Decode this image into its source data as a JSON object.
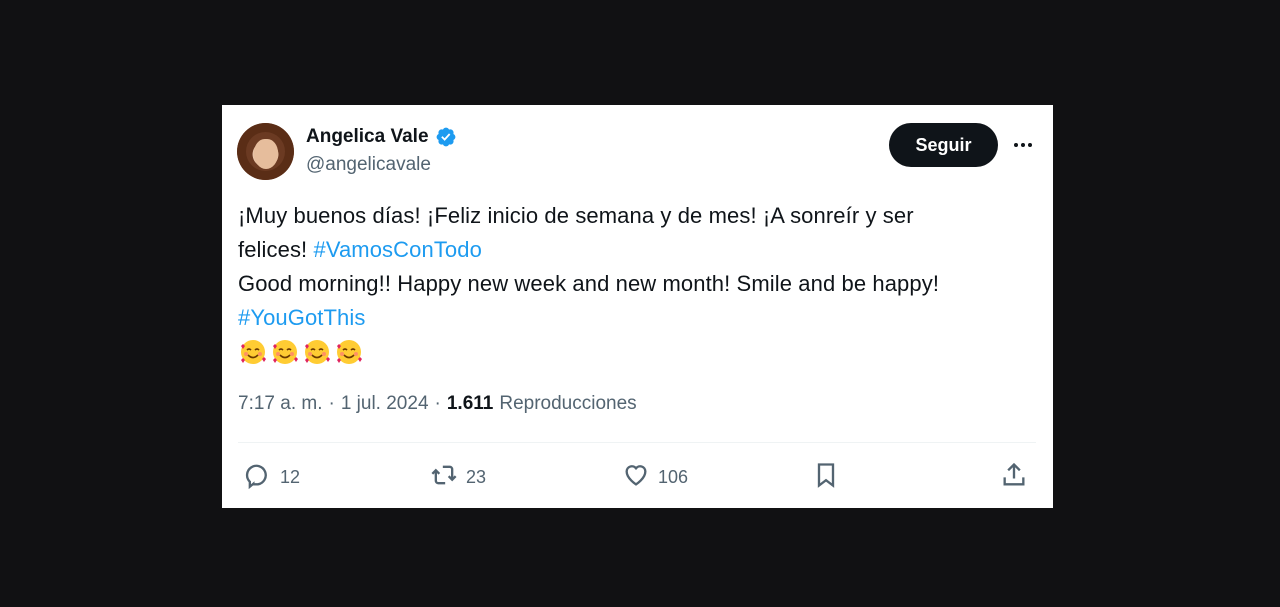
{
  "author": {
    "name": "Angelica Vale",
    "handle": "@angelicavale",
    "verified": true
  },
  "follow_label": "Seguir",
  "tweet": {
    "line1": "¡Muy buenos días! ¡Feliz inicio de semana y de mes! ¡A sonreír y ser",
    "line2_text": "felices! ",
    "hashtag1": "#VamosConTodo",
    "line3": "Good morning!! Happy new week and new month! Smile and be happy!",
    "hashtag2": "#YouGotThis",
    "emoji_count": 4,
    "emoji": "smiling-face-with-hearts"
  },
  "meta": {
    "time": "7:17 a. m.",
    "sep1": "·",
    "date": "1 jul. 2024",
    "sep2": "·",
    "views_count": "1.611",
    "views_label": "Reproducciones"
  },
  "actions": {
    "replies": "12",
    "retweets": "23",
    "likes": "106"
  },
  "colors": {
    "background": "#111113",
    "card": "#ffffff",
    "text": "#0f1419",
    "secondary": "#536471",
    "accent": "#1d9bf0",
    "button": "#0f1419"
  }
}
